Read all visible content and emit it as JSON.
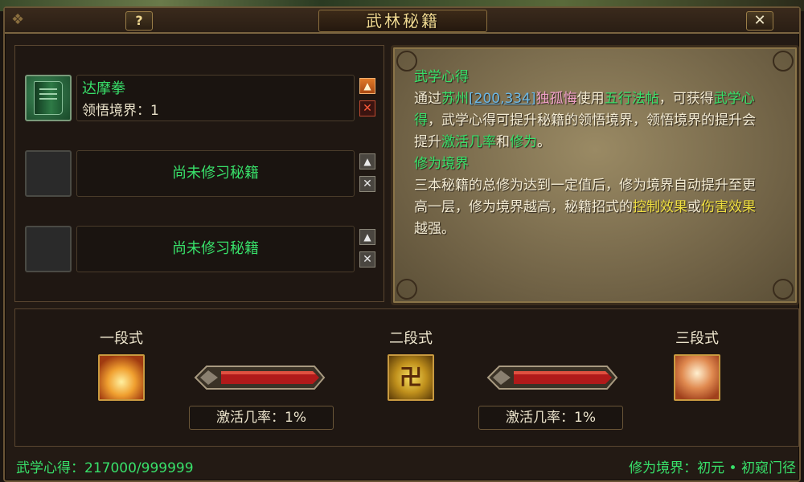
{
  "window": {
    "title": "武林秘籍",
    "help_label": "?",
    "close_label": "✕"
  },
  "slots": [
    {
      "name": "达摩拳",
      "level": "领悟境界：1",
      "icon": "book-icon"
    },
    {
      "empty_label": "尚未修习秘籍"
    },
    {
      "empty_label": "尚未修习秘籍"
    }
  ],
  "info": {
    "heading1": "武学心得",
    "p1_a": "通过",
    "p1_place": "苏州",
    "p1_coords": "[200,334]",
    "p1_npc": "独孤悔",
    "p1_b": "使用",
    "p1_item": "五行法帖",
    "p1_c": "，可获得",
    "p1_gain": "武学心得",
    "p1_d": "，武学心得可提升秘籍的领悟境界，领悟境界的提升会提升",
    "p1_rate": "激活几率",
    "p1_e": "和",
    "p1_cult": "修为",
    "p1_f": "。",
    "heading2": "修为境界",
    "p2_a": "三本秘籍的总修为达到一定值后，修为境界自动提升至更高一层，修为境界越高，秘籍招式的",
    "p2_ctrl": "控制效果",
    "p2_b": "或",
    "p2_dmg": "伤害效果",
    "p2_c": "越强。"
  },
  "stages": [
    {
      "label": "一段式"
    },
    {
      "label": "二段式",
      "glyph": "卍"
    },
    {
      "label": "三段式"
    }
  ],
  "rates": [
    {
      "text": "激活几率：1%"
    },
    {
      "text": "激活几率：1%"
    }
  ],
  "footer": {
    "left": "武学心得：217000/999999",
    "right": "修为境界：初元 • 初窥门径"
  },
  "colors": {
    "highlight_green": "#38e06a",
    "highlight_yellow": "#f0e040",
    "link_blue": "#6ab8e8",
    "npc_pink": "#f0a0c8",
    "frame_gold": "#c89a40"
  }
}
